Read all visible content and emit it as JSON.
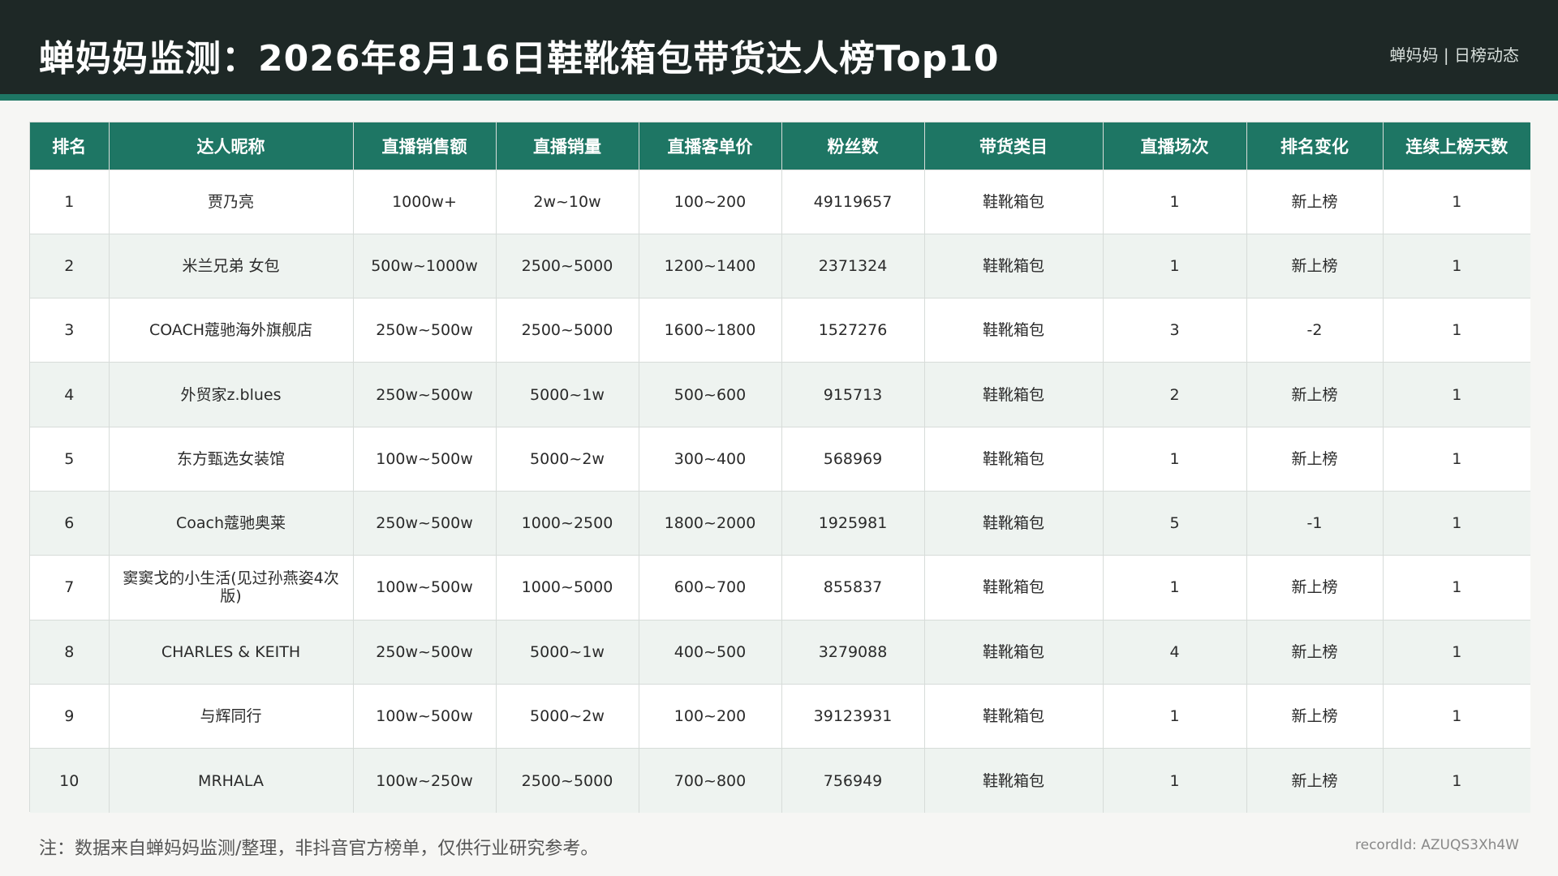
{
  "header": {
    "title": "蝉妈妈监测：2026年8月16日鞋靴箱包带货达人榜Top10",
    "brand": "蝉妈妈 | 日榜动态"
  },
  "table": {
    "columns": [
      "排名",
      "达人昵称",
      "直播销售额",
      "直播销量",
      "直播客单价",
      "粉丝数",
      "带货类目",
      "直播场次",
      "排名变化",
      "连续上榜天数"
    ],
    "rows": [
      [
        "1",
        "贾乃亮",
        "1000w+",
        "2w~10w",
        "100~200",
        "49119657",
        "鞋靴箱包",
        "1",
        "新上榜",
        "1"
      ],
      [
        "2",
        "米兰兄弟 女包",
        "500w~1000w",
        "2500~5000",
        "1200~1400",
        "2371324",
        "鞋靴箱包",
        "1",
        "新上榜",
        "1"
      ],
      [
        "3",
        "COACH蔻驰海外旗舰店",
        "250w~500w",
        "2500~5000",
        "1600~1800",
        "1527276",
        "鞋靴箱包",
        "3",
        "-2",
        "1"
      ],
      [
        "4",
        "外贸家z.blues",
        "250w~500w",
        "5000~1w",
        "500~600",
        "915713",
        "鞋靴箱包",
        "2",
        "新上榜",
        "1"
      ],
      [
        "5",
        "东方甄选女装馆",
        "100w~500w",
        "5000~2w",
        "300~400",
        "568969",
        "鞋靴箱包",
        "1",
        "新上榜",
        "1"
      ],
      [
        "6",
        "Coach蔻驰奥莱",
        "250w~500w",
        "1000~2500",
        "1800~2000",
        "1925981",
        "鞋靴箱包",
        "5",
        "-1",
        "1"
      ],
      [
        "7",
        "窦窦戈的小生活(见过孙燕姿4次版)",
        "100w~500w",
        "1000~5000",
        "600~700",
        "855837",
        "鞋靴箱包",
        "1",
        "新上榜",
        "1"
      ],
      [
        "8",
        "CHARLES & KEITH",
        "250w~500w",
        "5000~1w",
        "400~500",
        "3279088",
        "鞋靴箱包",
        "4",
        "新上榜",
        "1"
      ],
      [
        "9",
        "与辉同行",
        "100w~500w",
        "5000~2w",
        "100~200",
        "39123931",
        "鞋靴箱包",
        "1",
        "新上榜",
        "1"
      ],
      [
        "10",
        "MRHALA",
        "100w~250w",
        "2500~5000",
        "700~800",
        "756949",
        "鞋靴箱包",
        "1",
        "新上榜",
        "1"
      ]
    ]
  },
  "footer": {
    "note": "注：数据来自蝉妈妈监测/整理，非抖音官方榜单，仅供行业研究参考。",
    "record_id": "recordId: AZUQS3Xh4W"
  }
}
